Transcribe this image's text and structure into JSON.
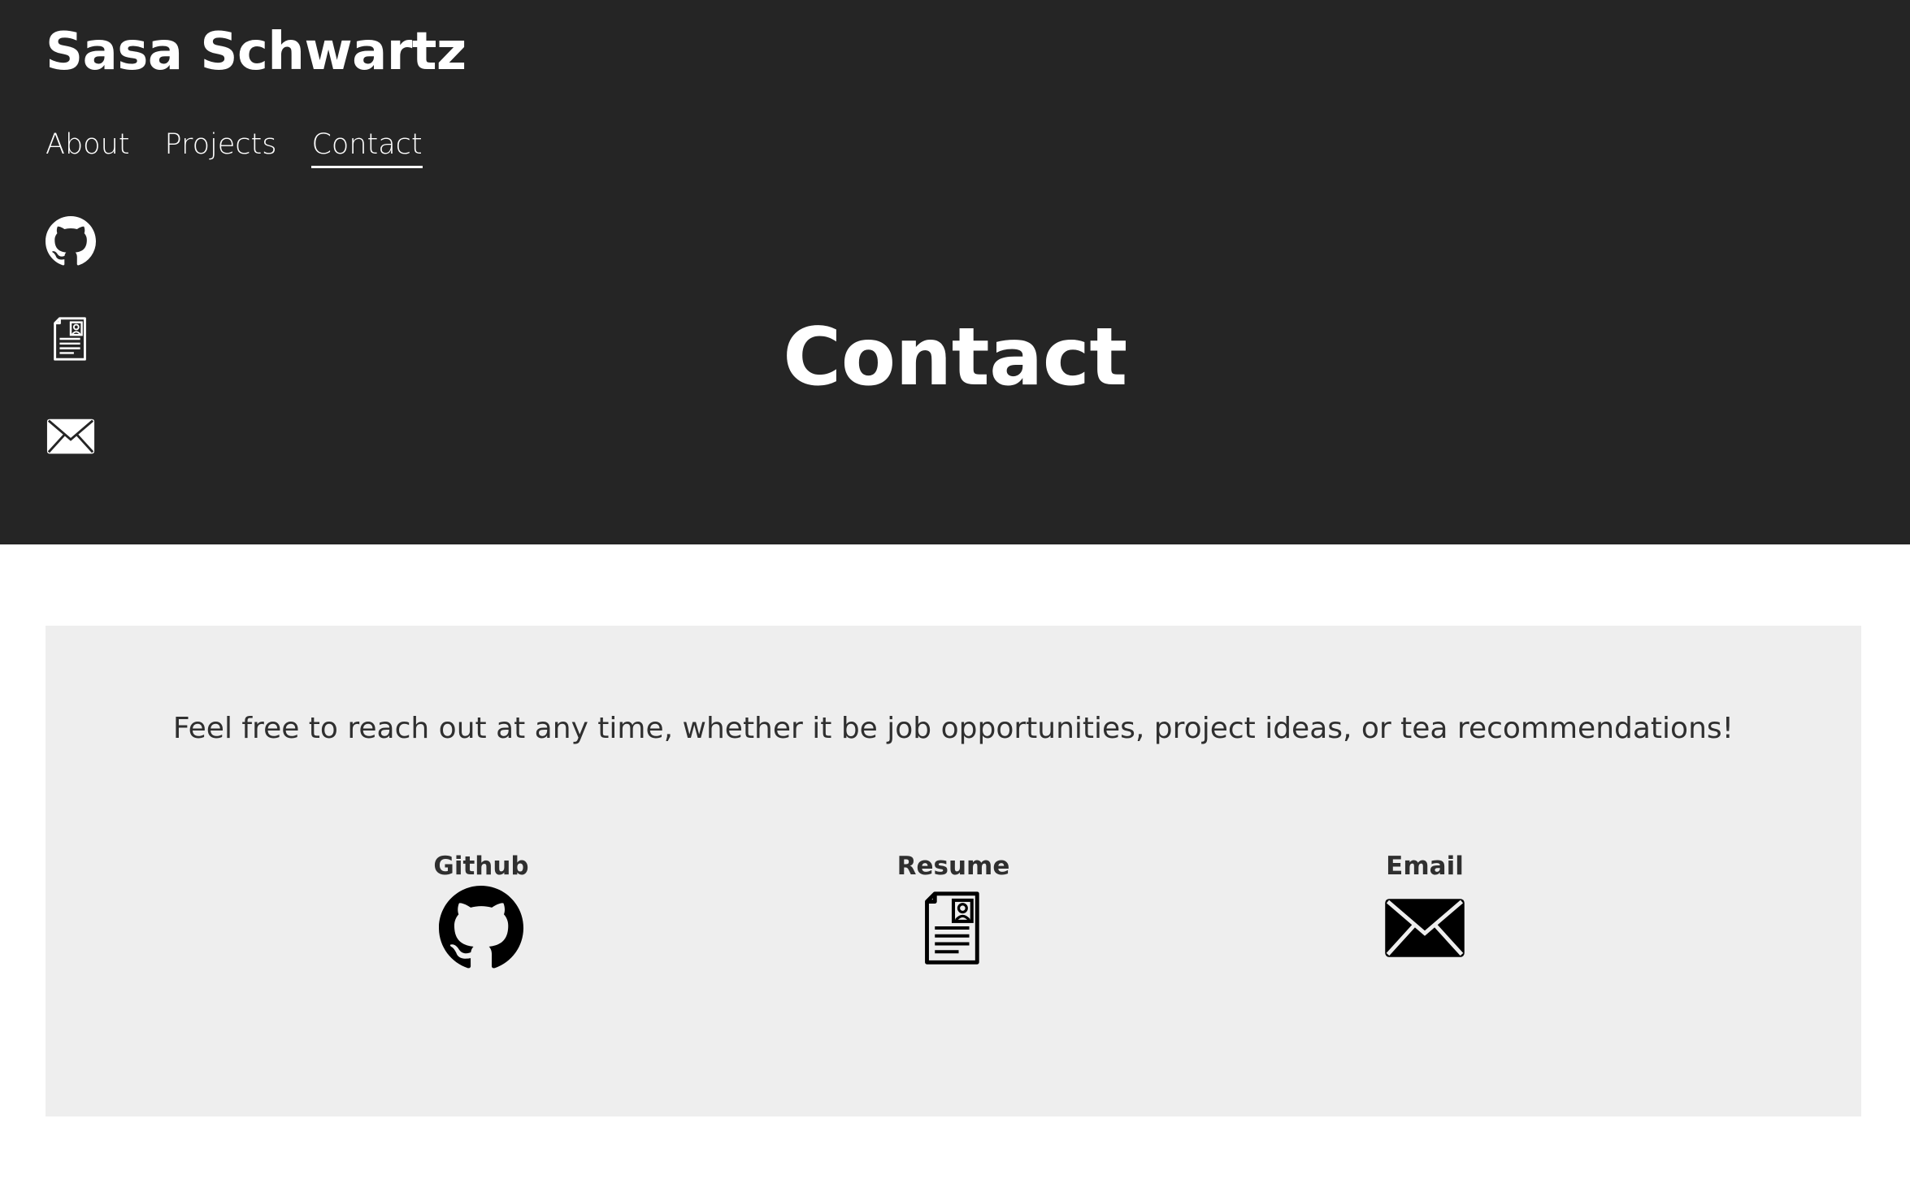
{
  "header": {
    "site_title": "Sasa Schwartz",
    "nav": [
      {
        "label": "About",
        "active": false
      },
      {
        "label": "Projects",
        "active": false
      },
      {
        "label": "Contact",
        "active": true
      }
    ],
    "side_icons": [
      "github-icon",
      "resume-icon",
      "email-icon"
    ],
    "page_heading": "Contact"
  },
  "contact": {
    "intro_text": "Feel free to reach out at any time, whether it be job opportunities, project ideas, or tea recommendations!",
    "links": [
      {
        "label": "Github",
        "icon": "github-icon"
      },
      {
        "label": "Resume",
        "icon": "resume-icon"
      },
      {
        "label": "Email",
        "icon": "email-icon"
      }
    ]
  },
  "colors": {
    "header_bg": "#252525",
    "card_bg": "#eeeeee",
    "text_dark": "#2f2f2f",
    "text_light": "#ffffff"
  }
}
